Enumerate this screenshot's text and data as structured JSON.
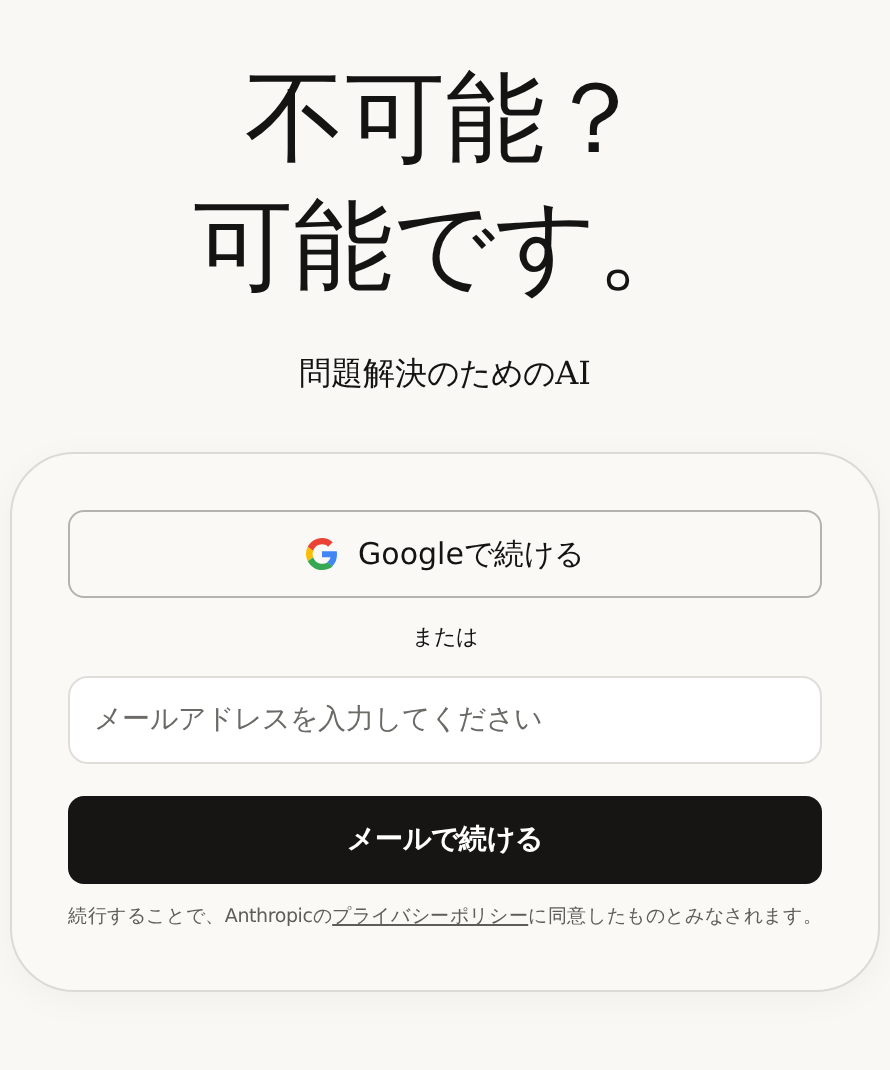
{
  "headline": [
    "不可能？",
    "可能です。"
  ],
  "tagline": "問題解決のためのAI",
  "login": {
    "google_button": "Googleで続ける",
    "divider": "または",
    "email_field": {
      "placeholder": "メールアドレスを入力してください"
    },
    "email_button": "メールで続ける",
    "disclaimer": {
      "before": "続行することで、Anthropicの",
      "link": "プライバシーポリシー",
      "after": "に同意したものとみなされます。"
    }
  }
}
